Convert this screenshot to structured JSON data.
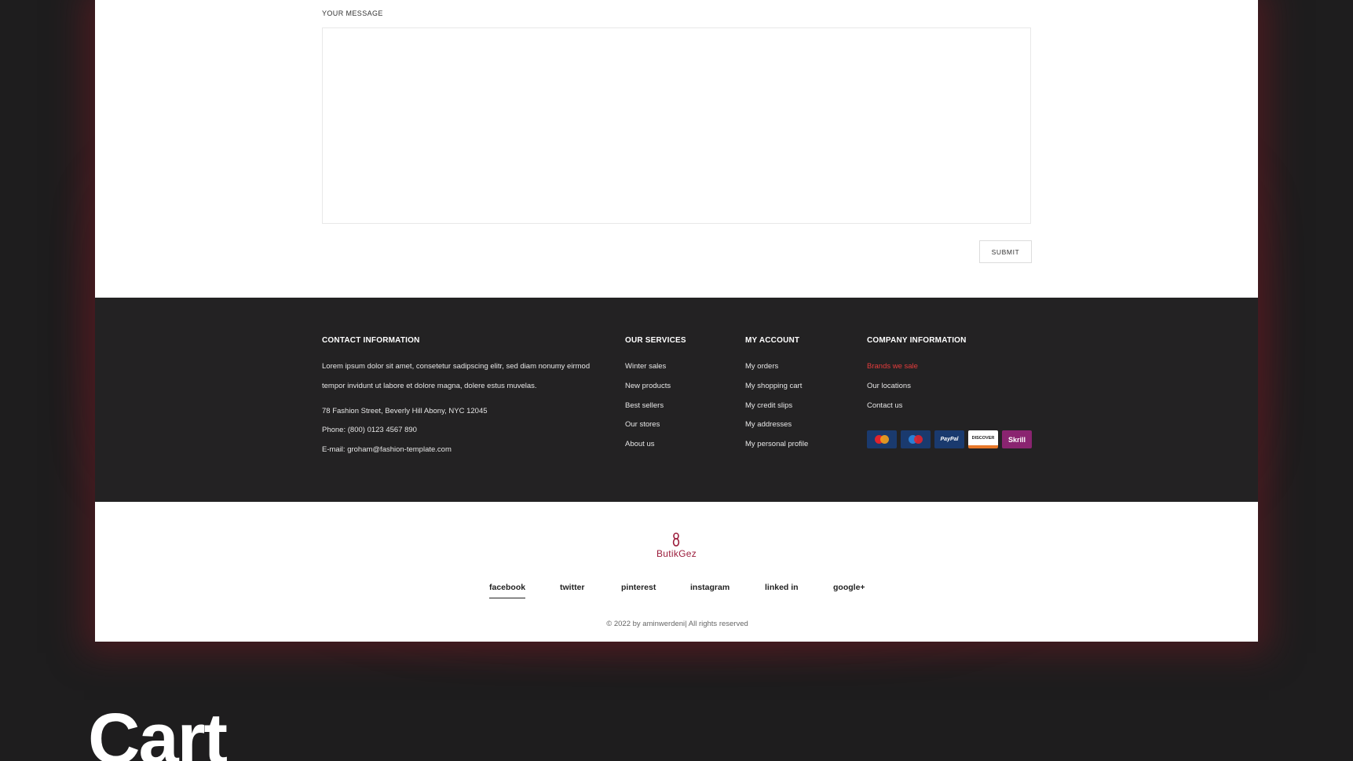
{
  "contact_form": {
    "message_label": "YOUR MESSAGE",
    "message_value": "",
    "submit_label": "SUBMIT"
  },
  "footer": {
    "contact": {
      "title": "CONTACT INFORMATION",
      "description_line1": "Lorem ipsum dolor sit amet, consetetur sadipscing elitr, sed diam nonumy eirmod",
      "description_line2": "tempor invidunt ut labore et dolore magna, dolere estus muvelas.",
      "address": "78 Fashion Street, Beverly Hill Abony, NYC 12045",
      "phone": "Phone: (800) 0123 4567 890",
      "email": "E-mail:  groham@fashion-template.com"
    },
    "services": {
      "title": "OUR SERVICES",
      "items": [
        "Winter sales",
        "New products",
        "Best sellers",
        "Our stores",
        "About us"
      ]
    },
    "account": {
      "title": "MY ACCOUNT",
      "items": [
        "My orders",
        "My shopping cart",
        "My credit slips",
        "My addresses",
        "My personal profile"
      ]
    },
    "company": {
      "title": "COMPANY INFORMATION",
      "items": [
        "Brands we sale",
        "Our locations",
        "Contact us"
      ],
      "accent_color": "#e53c3c"
    },
    "payments": [
      {
        "name": "mastercard",
        "label": "",
        "color": "#1a3a6e"
      },
      {
        "name": "maestro",
        "label": "",
        "color": "#1a3a6e"
      },
      {
        "name": "paypal",
        "label": "PayPal",
        "color": "#1a3a6e"
      },
      {
        "name": "discover",
        "label": "DISCOVER",
        "color": "#ffffff"
      },
      {
        "name": "skrill",
        "label": "Skrill",
        "color": "#8a2470"
      }
    ]
  },
  "bottom": {
    "logo_text": "ButikGez",
    "brand_color": "#9b1c3b",
    "social": [
      "facebook",
      "twitter",
      "pinterest",
      "instagram",
      "linked in",
      "google+"
    ],
    "copyright": "© 2022 by aminwerdeni| All rights reserved"
  },
  "section_heading": "Cart"
}
